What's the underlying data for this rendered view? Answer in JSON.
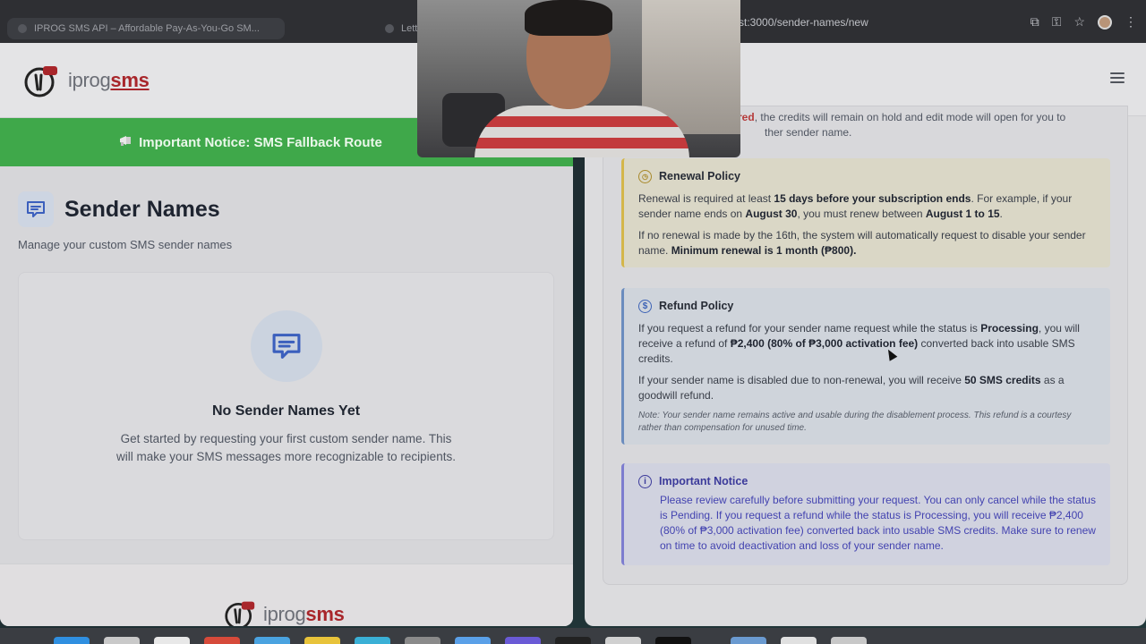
{
  "browser_left": {
    "tabs": [
      {
        "label": "IPROG SMS API – Affordable Pay-As-You-Go SM..."
      },
      {
        "label": "Lette"
      }
    ]
  },
  "browser_right": {
    "url": "st:3000/sender-names/new"
  },
  "site": {
    "logo_prefix": "iprog",
    "logo_suffix": "sms",
    "notice": "Important Notice: SMS Fallback Route"
  },
  "sender_names": {
    "title": "Sender Names",
    "subtitle": "Manage your custom SMS sender names",
    "empty_title": "No Sender Names Yet",
    "empty_text": "Get started by requesting your first custom sender name. This will make your SMS messages more recognizable to recipients."
  },
  "form": {
    "cut_text_red": "red",
    "cut_text_1": ", the credits will remain on hold and edit mode will open for you to",
    "cut_text_2": "ther sender name.",
    "renewal": {
      "heading": "Renewal Policy",
      "p1_a": "Renewal is required at least ",
      "p1_b": "15 days before your subscription ends",
      "p1_c": ". For example, if your sender name ends on ",
      "p1_d": "August 30",
      "p1_e": ", you must renew between ",
      "p1_f": "August 1 to 15",
      "p1_g": ".",
      "p2_a": "If no renewal is made by the 16th, the system will automatically request to disable your sender name. ",
      "p2_b": "Minimum renewal is 1 month (₱800)."
    },
    "refund": {
      "heading": "Refund Policy",
      "p1_a": "If you request a refund for your sender name request while the status is ",
      "p1_b": "Processing",
      "p1_c": ", you will receive a refund of ",
      "p1_d": "₱2,400 (80% of ₱3,000 activation fee)",
      "p1_e": " converted back into usable SMS credits.",
      "p2_a": "If your sender name is disabled due to non-renewal, you will receive ",
      "p2_b": "50 SMS credits",
      "p2_c": " as a goodwill refund.",
      "note": "Note: Your sender name remains active and usable during the disablement process. This refund is a courtesy rather than compensation for unused time."
    },
    "important": {
      "heading": "Important Notice",
      "text": "Please review carefully before submitting your request. You can only cancel while the status is Pending. If you request a refund while the status is Processing, you will receive ₱2,400 (80% of ₱3,000 activation fee) converted back into usable SMS credits. Make sure to renew on time to avoid deactivation and loss of your sender name."
    }
  },
  "icons": {
    "megaphone": "megaphone-icon",
    "message": "message-icon",
    "clock": "clock-icon",
    "dollar": "dollar-icon",
    "info": "info-icon",
    "menu": "hamburger-menu-icon"
  },
  "colors": {
    "notice_green": "#3fa84a",
    "brand_red": "#a8262b",
    "renewal_accent": "#d4b64a",
    "refund_accent": "#6b8cbe",
    "important_accent": "#7d7dcf"
  }
}
